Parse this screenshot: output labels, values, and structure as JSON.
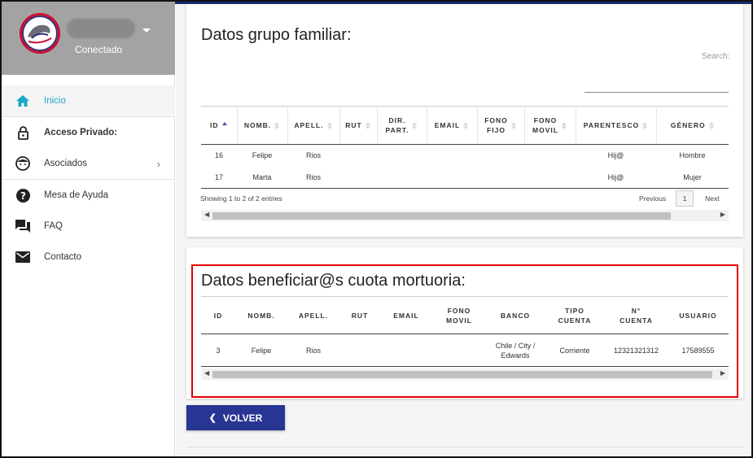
{
  "sidebar": {
    "status": "Conectado",
    "items": [
      {
        "label": "Inicio",
        "icon": "home-icon"
      },
      {
        "label": "Acceso Privado:",
        "icon": "lock-icon"
      },
      {
        "label": "Asociados",
        "icon": "face-icon"
      },
      {
        "label": "Mesa de Ayuda",
        "icon": "help-icon"
      },
      {
        "label": "FAQ",
        "icon": "forum-icon"
      },
      {
        "label": "Contacto",
        "icon": "mail-icon"
      }
    ]
  },
  "familiar": {
    "title": "Datos grupo familiar:",
    "search_label": "Search:",
    "columns": [
      {
        "l1": "ID",
        "l2": ""
      },
      {
        "l1": "NOMB.",
        "l2": ""
      },
      {
        "l1": "APELL.",
        "l2": ""
      },
      {
        "l1": "RUT",
        "l2": ""
      },
      {
        "l1": "DIR.",
        "l2": "PART."
      },
      {
        "l1": "EMAIL",
        "l2": ""
      },
      {
        "l1": "FONO",
        "l2": "FIJO"
      },
      {
        "l1": "FONO",
        "l2": "MOVIL"
      },
      {
        "l1": "PARENTESCO",
        "l2": ""
      },
      {
        "l1": "GÉNERO",
        "l2": ""
      }
    ],
    "rows": [
      [
        "16",
        "Felipe",
        "Rios",
        "",
        "",
        "",
        "",
        "",
        "Hij@",
        "Hombre"
      ],
      [
        "17",
        "Marta",
        "Rios",
        "",
        "",
        "",
        "",
        "",
        "Hij@",
        "Mujer"
      ]
    ],
    "info": "Showing 1 to 2 of 2 entries",
    "previous": "Previous",
    "page": "1",
    "next": "Next"
  },
  "beneficiarios": {
    "title": "Datos beneficiar@s cuota mortuoria:",
    "columns": [
      {
        "l1": "ID",
        "l2": ""
      },
      {
        "l1": "NOMB.",
        "l2": ""
      },
      {
        "l1": "APELL.",
        "l2": ""
      },
      {
        "l1": "RUT",
        "l2": ""
      },
      {
        "l1": "EMAIL",
        "l2": ""
      },
      {
        "l1": "FONO",
        "l2": "MOVIL"
      },
      {
        "l1": "BANCO",
        "l2": ""
      },
      {
        "l1": "TIPO",
        "l2": "CUENTA"
      },
      {
        "l1": "N°",
        "l2": "CUENTA"
      },
      {
        "l1": "USUARIO",
        "l2": ""
      }
    ],
    "rows": [
      {
        "c": [
          "3",
          "Felipe",
          "Rios",
          "",
          "",
          "",
          "",
          "Corriente",
          "12321321312",
          "17589555"
        ],
        "banco1": "Chile / City /",
        "banco2": "Edwards"
      }
    ]
  },
  "volver_label": "VOLVER",
  "colors": {
    "accent": "#283593",
    "active": "#1aa7c4",
    "highlight": "#e00000",
    "header": "#a3a3a3"
  }
}
